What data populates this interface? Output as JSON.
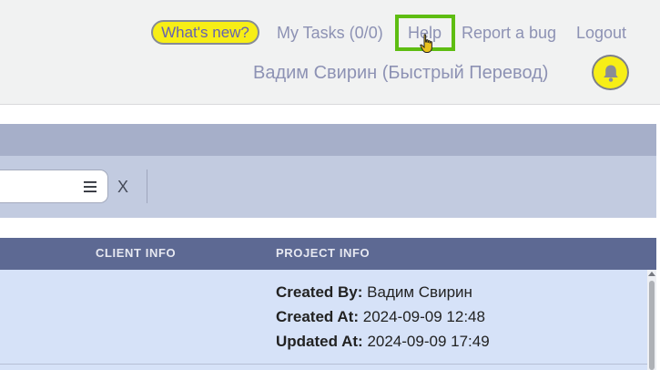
{
  "header": {
    "whats_new": "What's new?",
    "my_tasks": "My Tasks (0/0)",
    "help": "Help",
    "report_bug": "Report a bug",
    "logout": "Logout",
    "user_name": "Вадим Свирин (Быстрый Перевод)",
    "bell_icon": "bell-icon"
  },
  "filter": {
    "value": "",
    "menu_icon": "hamburger-menu-icon",
    "clear_label": "X"
  },
  "table": {
    "columns": [
      "CLIENT INFO",
      "PROJECT INFO"
    ],
    "rows": [
      {
        "project_info": {
          "created_by_label": "Created By:",
          "created_by_value": "Вадим Свирин",
          "created_at_label": "Created At:",
          "created_at_value": "2024-09-09 12:48",
          "updated_at_label": "Updated At:",
          "updated_at_value": "2024-09-09 17:49"
        }
      }
    ]
  },
  "colors": {
    "header_bg": "#f1f2f2",
    "link": "#8d92b4",
    "highlight_yellow": "#f7ee16",
    "focus_green": "#5ebd12",
    "table_header": "#5d6993",
    "row_bg": "#d6e2f8"
  }
}
